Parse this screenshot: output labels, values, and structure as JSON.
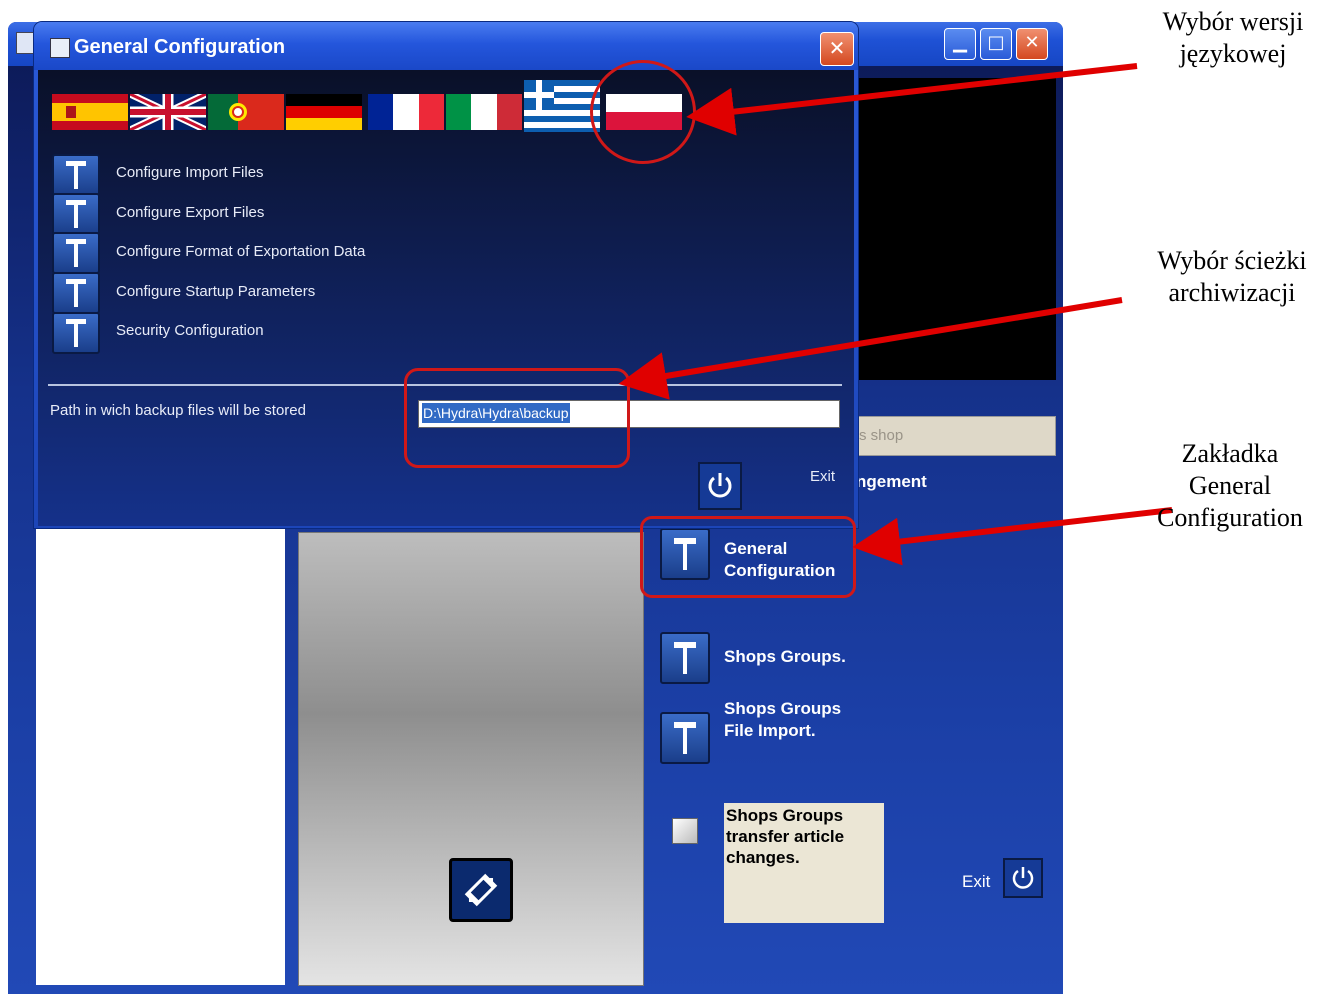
{
  "main_window": {
    "shop_field_text": "s shop",
    "management_label": "ngement",
    "side_items": [
      {
        "label_line1": "General",
        "label_line2": "Configuration"
      },
      {
        "label_line1": "Shops Groups.",
        "label_line2": ""
      },
      {
        "label_line1": "Shops Groups",
        "label_line2": "File Import."
      }
    ],
    "transfer": {
      "line1": "Shops Groups",
      "line2": "transfer article",
      "line3": "changes."
    },
    "exit_label": "Exit"
  },
  "dialog": {
    "title": "General Configuration",
    "close_glyph": "✕",
    "flags": [
      "spain-flag",
      "uk-flag",
      "portugal-flag",
      "germany-flag",
      "france-flag",
      "italy-flag",
      "greece-flag",
      "poland-flag"
    ],
    "menu": [
      {
        "label": "Configure Import Files"
      },
      {
        "label": "Configure Export Files"
      },
      {
        "label": "Configure Format of Exportation Data"
      },
      {
        "label": "Configure Startup Parameters"
      },
      {
        "label": "Security Configuration"
      }
    ],
    "backup_label": "Path in wich backup files will be stored",
    "backup_value": "D:\\Hydra\\Hydra\\backup",
    "exit_label": "Exit"
  },
  "annotations": {
    "language": {
      "line1": "Wybór wersji",
      "line2": "językowej"
    },
    "archive": {
      "line1": "Wybór ścieżki",
      "line2": "archiwizacji"
    },
    "general": {
      "line1": "Zakładka",
      "line2": "General",
      "line3": "Configuration"
    }
  },
  "colors": {
    "annotation_red": "#e00000",
    "window_blue": "#1f52d6",
    "selection": "#316ac5"
  }
}
